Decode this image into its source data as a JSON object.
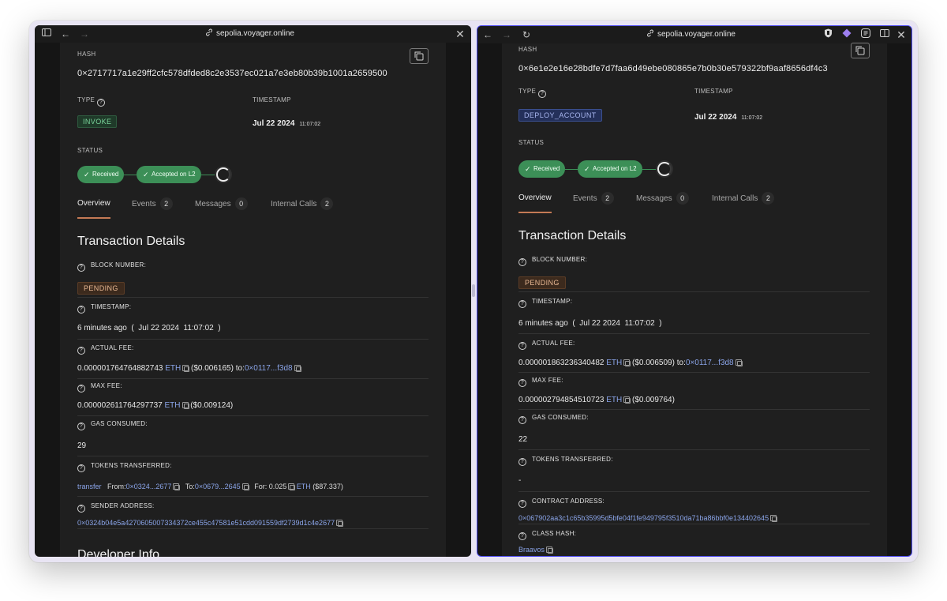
{
  "left_window": {
    "url": "sepolia.voyager.online",
    "hash_label": "HASH",
    "hash": "0×2717717a1e29ff2cfc578dfded8c2e3537ec021a7e3eb80b39b1001a2659500",
    "type_label": "TYPE",
    "type_value": "INVOKE",
    "timestamp_label": "TIMESTAMP",
    "timestamp_date": "Jul 22 2024",
    "timestamp_time": "11:07:02",
    "status_label": "STATUS",
    "status_steps": [
      "Received",
      "Accepted on L2"
    ],
    "tabs": [
      {
        "label": "Overview",
        "count": ""
      },
      {
        "label": "Events",
        "count": "2"
      },
      {
        "label": "Messages",
        "count": "0"
      },
      {
        "label": "Internal Calls",
        "count": "2"
      }
    ],
    "section_title": "Transaction Details",
    "block_number_label": "BLOCK NUMBER:",
    "block_number_value": "PENDING",
    "timestamp_row_label": "TIMESTAMP:",
    "timestamp_row_value": "6 minutes ago  (  Jul 22 2024  11:07:02  )",
    "actual_fee_label": "ACTUAL FEE:",
    "actual_fee_amount": "0.000001764764882743",
    "actual_fee_unit": "ETH",
    "actual_fee_usd": "($0.006165)",
    "actual_fee_to_label": "to:",
    "actual_fee_to": "0×0117...f3d8",
    "max_fee_label": "MAX FEE:",
    "max_fee_amount": "0.000002611764297737",
    "max_fee_unit": "ETH",
    "max_fee_usd": "($0.009124)",
    "gas_label": "GAS CONSUMED:",
    "gas_value": "29",
    "tokens_label": "TOKENS TRANSFERRED:",
    "transfer_type": "transfer",
    "from_label": "From:",
    "from_value": "0×0324...2677",
    "to_label": "To:",
    "to_value": "0×0679...2645",
    "for_label": "For:",
    "for_amount": "0.025",
    "for_unit": "ETH",
    "for_usd": "($87.337)",
    "sender_label": "SENDER ADDRESS:",
    "sender_value": "0×0324b04e5a4270605007334372ce455c47581e51cdd091559df2739d1c4e2677",
    "next_section_title": "Developer Info"
  },
  "right_window": {
    "url": "sepolia.voyager.online",
    "hash_label": "HASH",
    "hash": "0×6e1e2e16e28bdfe7d7faa6d49ebe080865e7b0b30e579322bf9aaf8656df4c3",
    "type_label": "TYPE",
    "type_value": "DEPLOY_ACCOUNT",
    "timestamp_label": "TIMESTAMP",
    "timestamp_date": "Jul 22 2024",
    "timestamp_time": "11:07:02",
    "status_label": "STATUS",
    "status_steps": [
      "Received",
      "Accepted on L2"
    ],
    "tabs": [
      {
        "label": "Overview",
        "count": ""
      },
      {
        "label": "Events",
        "count": "2"
      },
      {
        "label": "Messages",
        "count": "0"
      },
      {
        "label": "Internal Calls",
        "count": "2"
      }
    ],
    "section_title": "Transaction Details",
    "block_number_label": "BLOCK NUMBER:",
    "block_number_value": "PENDING",
    "timestamp_row_label": "TIMESTAMP:",
    "timestamp_row_value": "6 minutes ago  (  Jul 22 2024  11:07:02  )",
    "actual_fee_label": "ACTUAL FEE:",
    "actual_fee_amount": "0.000001863236340482",
    "actual_fee_unit": "ETH",
    "actual_fee_usd": "($0.006509)",
    "actual_fee_to_label": "to:",
    "actual_fee_to": "0×0117...f3d8",
    "max_fee_label": "MAX FEE:",
    "max_fee_amount": "0.000002794854510723",
    "max_fee_unit": "ETH",
    "max_fee_usd": "($0.009764)",
    "gas_label": "GAS CONSUMED:",
    "gas_value": "22",
    "tokens_label": "TOKENS TRANSFERRED:",
    "tokens_value": "-",
    "contract_label": "CONTRACT ADDRESS:",
    "contract_value": "0×067902aa3c1c65b35995d5bfe04f1fe949795f3510da71ba86bbf0e134402645",
    "class_hash_label": "CLASS HASH:",
    "class_hash_value": "Braavos"
  },
  "icons": {
    "sidebar": "sidebar-toggle-icon",
    "back": "arrow-left-icon",
    "forward": "arrow-right-icon",
    "reload": "reload-icon",
    "close": "close-icon",
    "link": "link-icon",
    "copy": "copy-icon",
    "help": "question-circle-icon",
    "check": "check-icon"
  },
  "colors": {
    "accent_border": "#4c4af0",
    "success_green": "#3c8f57",
    "link_blue": "#8aa4e8",
    "tab_underline": "#c47a55"
  }
}
